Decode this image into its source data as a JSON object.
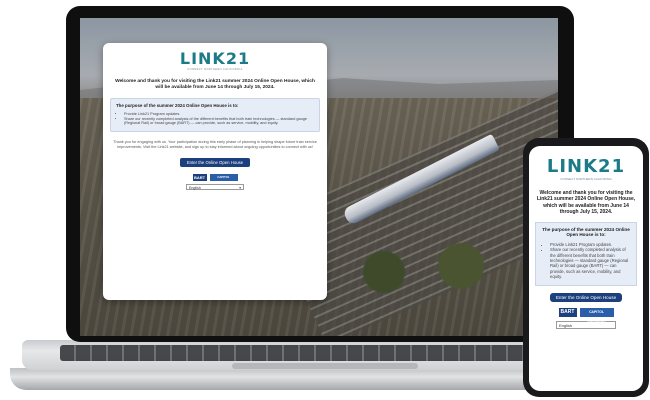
{
  "laptop_page": {
    "logo": {
      "main": "LINK21",
      "sub": "CONNECT NORTHERN CALIFORNIA"
    },
    "welcome": "Welcome and thank you for visiting the Link21 summer 2024 Online Open House, which will be available from June 14 through July 15, 2024.",
    "purpose_title": "The purpose of the summer 2024 Online Open House is to:",
    "purpose_items": [
      "Provide Link21 Program updates.",
      "Share our recently completed analysis of the different benefits that both train technologies — standard gauge (Regional Rail) or broad gauge (BART) — can provide, such as service, mobility, and equity."
    ],
    "thanks": "Thank you for engaging with us. Your participation during this early phase of planning is helping shape future train service improvements. Visit the Link21 website, and sign up to stay informed about ongoing opportunities to connect with us!",
    "cta": "Enter the Online Open House",
    "partners": {
      "bart": "BART",
      "capitol": "CAPITOL CORRIDOR"
    },
    "language": "English"
  },
  "phone_page": {
    "logo": {
      "main": "LINK21",
      "sub": "CONNECT NORTHERN CALIFORNIA"
    },
    "welcome": "Welcome and thank you for visiting the Link21 summer 2024 Online Open House, which will be available from June 14 through July 15, 2024.",
    "purpose_title": "The purpose of the summer 2024 Online Open House is to:",
    "purpose_items": [
      "Provide Link21 Program updates.",
      "Share our recently completed analysis of the different benefits that both train technologies — standard gauge (Regional Rail) or broad gauge (BART) — can provide, such as service, mobility, and equity."
    ],
    "cta": "Enter the Online Open House",
    "partners": {
      "bart": "BART",
      "capitol": "CAPITOL CORRIDOR"
    },
    "language": "English"
  },
  "colors": {
    "brand_teal": "#1b7b87",
    "cta_blue": "#1c3f7d",
    "purpose_bg": "#e7edf7"
  }
}
